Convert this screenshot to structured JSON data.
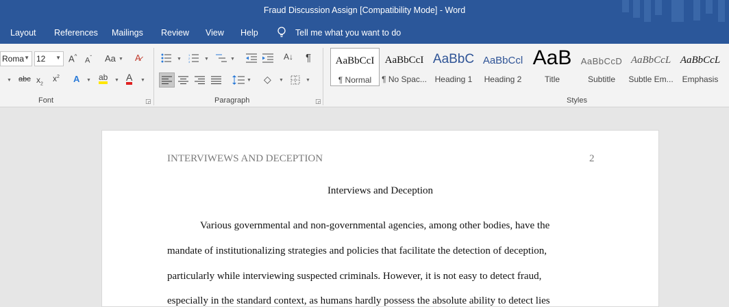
{
  "window": {
    "title": "Fraud Discussion Assign [Compatibility Mode]  -  Word"
  },
  "menu": {
    "tabs": [
      "Layout",
      "References",
      "Mailings",
      "Review",
      "View",
      "Help"
    ],
    "tell_me": "Tell me what you want to do"
  },
  "font_group": {
    "font_name": "Roma",
    "font_size": "12",
    "label": "Font"
  },
  "paragraph_group": {
    "label": "Paragraph"
  },
  "styles_group": {
    "label": "Styles",
    "items": [
      {
        "sample": "AaBbCcI",
        "name": "¶ Normal"
      },
      {
        "sample": "AaBbCcI",
        "name": "¶ No Spac..."
      },
      {
        "sample": "AaBbC",
        "name": "Heading 1"
      },
      {
        "sample": "AaBbCcl",
        "name": "Heading 2"
      },
      {
        "sample": "AaB",
        "name": "Title"
      },
      {
        "sample": "AaBbCcD",
        "name": "Subtitle"
      },
      {
        "sample": "AaBbCcL",
        "name": "Subtle Em..."
      },
      {
        "sample": "AaBbCcL",
        "name": "Emphasis"
      }
    ]
  },
  "document": {
    "running_head": "INTERVIWEWS AND DECEPTION",
    "page_number": "2",
    "title": "Interviews and Deception",
    "lines": [
      "Various governmental and non-governmental agencies, among other bodies, have the",
      "mandate of institutionalizing strategies and policies that facilitate the detection of deception,",
      "particularly while interviewing suspected criminals. However, it is not easy to detect fraud,",
      "especially in the standard context, as humans hardly possess the absolute ability to detect lies"
    ]
  },
  "colors": {
    "title_bar": "#2b579a",
    "ribbon": "#f3f3f3",
    "canvas": "#e6e6e6",
    "heading_blue": "#2f5496"
  }
}
